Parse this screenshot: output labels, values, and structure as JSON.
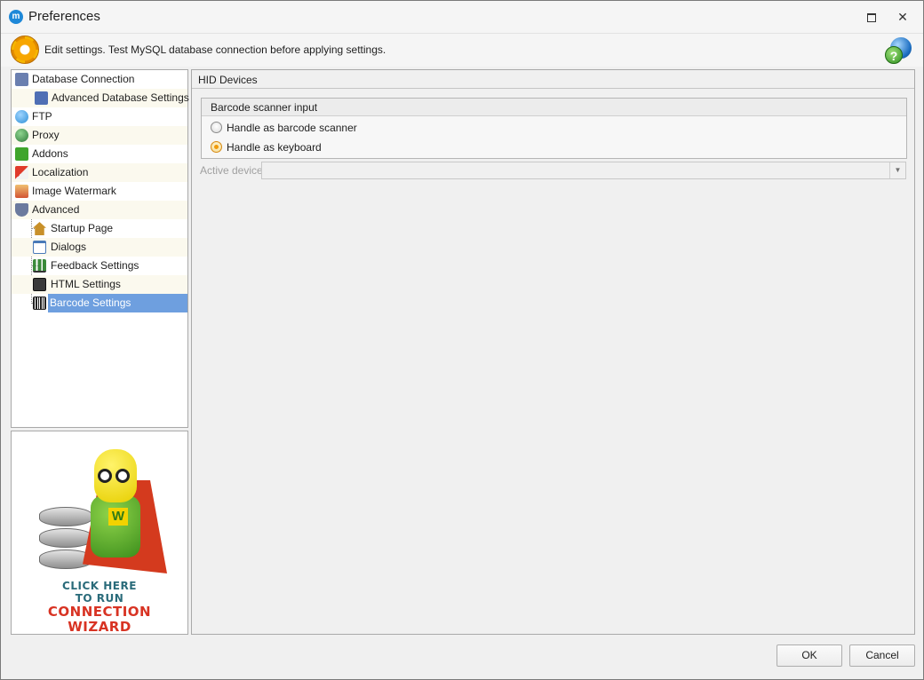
{
  "window": {
    "title": "Preferences",
    "app_icon_glyph": "m",
    "close_glyph": "✕"
  },
  "info": {
    "text": "Edit settings. Test MySQL database connection before applying settings.",
    "help_glyph": "?"
  },
  "tree": {
    "items": [
      {
        "label": "Database Connection",
        "icon": "database-icon",
        "color": "#6a7fb0"
      },
      {
        "label": "Advanced Database Settings",
        "icon": "database-settings-icon",
        "color": "#4f6fb5"
      },
      {
        "label": "FTP",
        "icon": "ftp-globe-icon",
        "color": "#2d8fd6"
      },
      {
        "label": "Proxy",
        "icon": "proxy-globe-icon",
        "color": "#2e7a3a"
      },
      {
        "label": "Addons",
        "icon": "puzzle-icon",
        "color": "#3fa52c"
      },
      {
        "label": "Localization",
        "icon": "localization-icon",
        "color": "#e03a2a"
      },
      {
        "label": "Image Watermark",
        "icon": "image-icon",
        "color": "#d25434"
      },
      {
        "label": "Advanced",
        "icon": "shield-icon",
        "color": "#6b7a9e"
      },
      {
        "label": "Startup Page",
        "icon": "home-icon",
        "color": "#c8902a"
      },
      {
        "label": "Dialogs",
        "icon": "dialog-icon",
        "color": "#4a7ab8"
      },
      {
        "label": "Feedback Settings",
        "icon": "bar-chart-icon",
        "color": "#3a8a3a"
      },
      {
        "label": "HTML Settings",
        "icon": "html-icon",
        "color": "#3a3a3a"
      },
      {
        "label": "Barcode Settings",
        "icon": "barcode-icon",
        "color": "#222222"
      }
    ],
    "selected": "Barcode Settings"
  },
  "wizard": {
    "line1": "CLICK HERE",
    "line2": "TO RUN",
    "line3": "CONNECTION",
    "line4": "WIZARD",
    "mascot_letter": "W"
  },
  "content": {
    "header": "HID Devices",
    "group_title": "Barcode scanner input",
    "option_scanner": "Handle as barcode scanner",
    "option_keyboard": "Handle as keyboard",
    "selected_option": "Handle as keyboard",
    "device_label": "Active device",
    "device_value": "",
    "dropdown_glyph": "▼"
  },
  "buttons": {
    "ok": "OK",
    "cancel": "Cancel"
  }
}
